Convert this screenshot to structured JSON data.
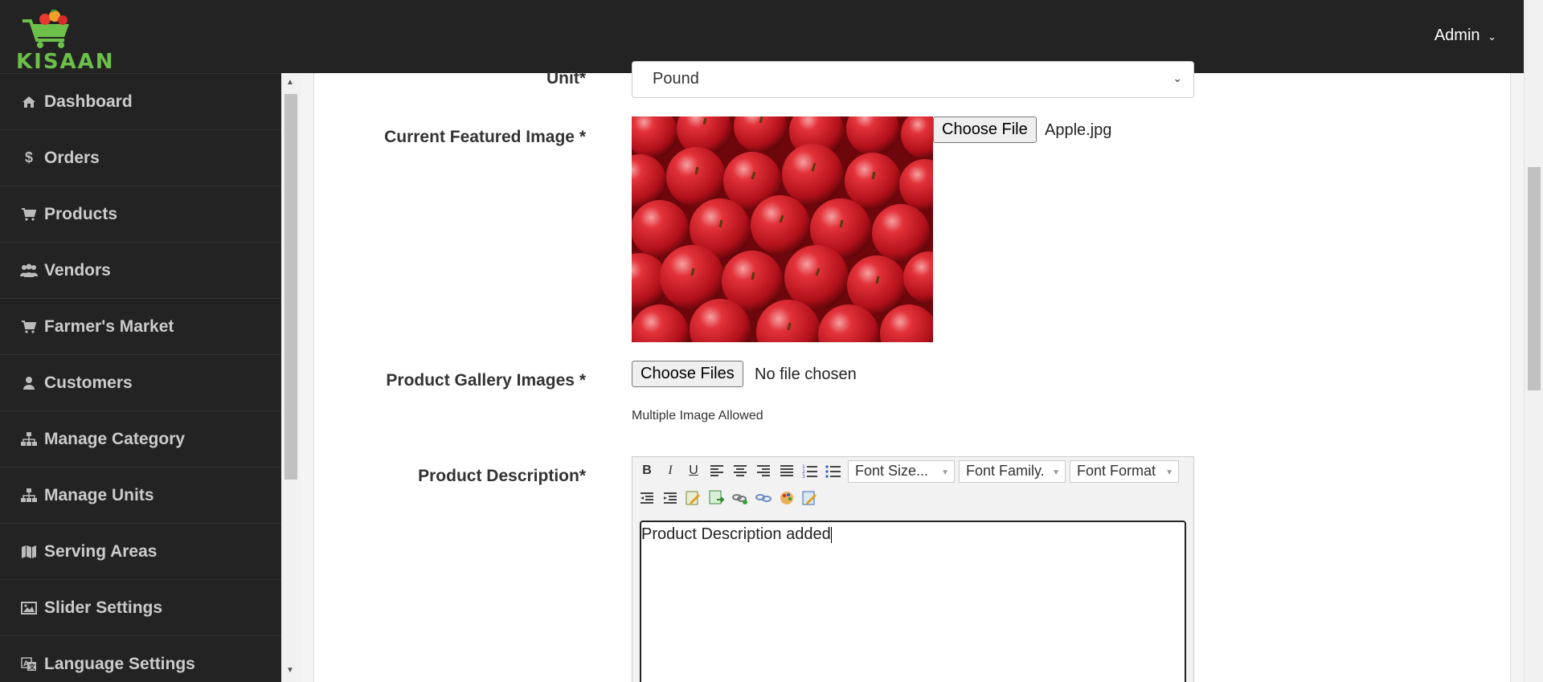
{
  "header": {
    "logo_text": "KISAAN",
    "user_menu": "Admin"
  },
  "sidebar": {
    "items": [
      {
        "label": "Dashboard",
        "icon": "home-icon"
      },
      {
        "label": "Orders",
        "icon": "dollar-icon"
      },
      {
        "label": "Products",
        "icon": "cart-icon"
      },
      {
        "label": "Vendors",
        "icon": "users-icon"
      },
      {
        "label": "Farmer's Market",
        "icon": "cart-icon"
      },
      {
        "label": "Customers",
        "icon": "user-icon"
      },
      {
        "label": "Manage Category",
        "icon": "sitemap-icon"
      },
      {
        "label": "Manage Units",
        "icon": "sitemap-icon"
      },
      {
        "label": "Serving Areas",
        "icon": "map-icon"
      },
      {
        "label": "Slider Settings",
        "icon": "image-icon"
      },
      {
        "label": "Language Settings",
        "icon": "language-icon"
      }
    ]
  },
  "form": {
    "unit": {
      "label": "Unit*",
      "value": "Pound"
    },
    "featured_image": {
      "label": "Current Featured Image *",
      "button": "Choose File",
      "file_name": "Apple.jpg"
    },
    "gallery": {
      "label": "Product Gallery Images *",
      "button": "Choose Files",
      "status": "No file chosen",
      "hint": "Multiple Image Allowed"
    },
    "description": {
      "label": "Product Description*",
      "toolbar": {
        "font_size": "Font Size...",
        "font_family": "Font Family.",
        "font_format": "Font Format"
      },
      "content": "Product Description added"
    }
  },
  "colors": {
    "topbar": "#232323",
    "logo_green": "#6cc04a",
    "apple_red": "#c4141c"
  }
}
